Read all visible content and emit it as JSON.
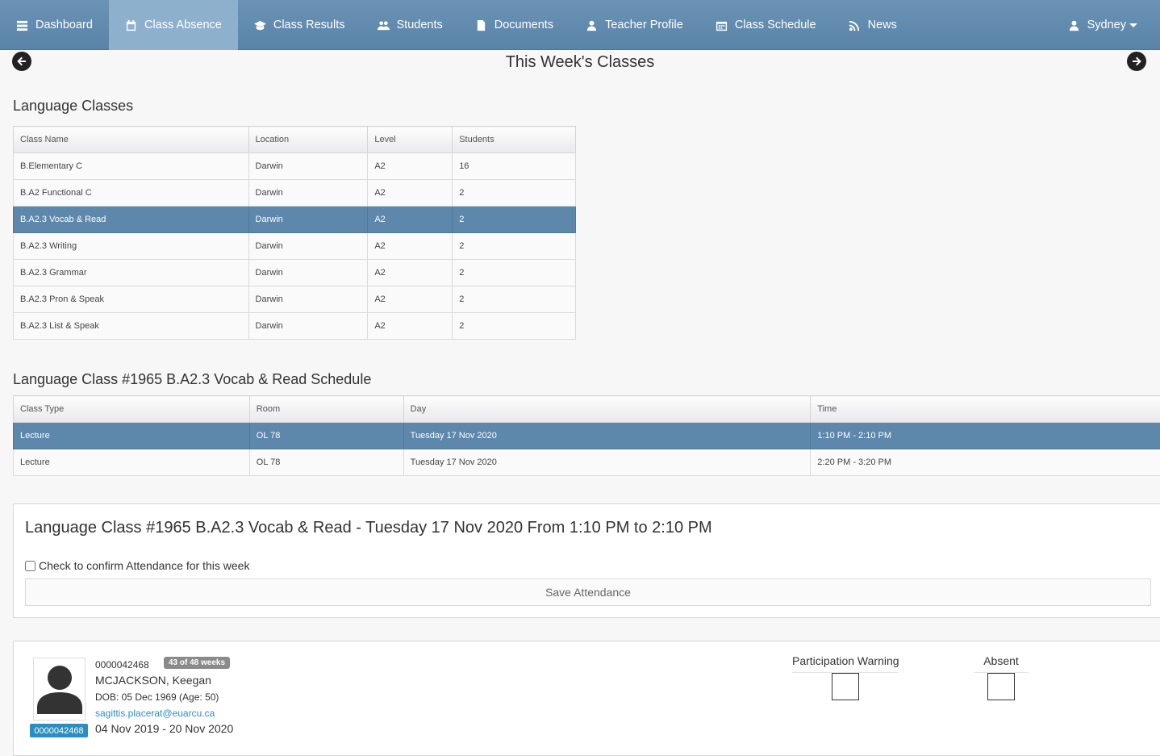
{
  "nav": {
    "items": [
      {
        "label": "Dashboard",
        "icon": "dashboard-icon"
      },
      {
        "label": "Class Absence",
        "icon": "calendar-icon",
        "active": true
      },
      {
        "label": "Class Results",
        "icon": "graduation-cap-icon"
      },
      {
        "label": "Students",
        "icon": "users-icon"
      },
      {
        "label": "Documents",
        "icon": "document-icon"
      },
      {
        "label": "Teacher Profile",
        "icon": "user-icon"
      },
      {
        "label": "Class Schedule",
        "icon": "calendar-grid-icon"
      },
      {
        "label": "News",
        "icon": "rss-icon"
      }
    ],
    "user": "Sydney"
  },
  "week": {
    "title": "This Week's Classes"
  },
  "language_classes": {
    "title": "Language Classes",
    "headers": [
      "Class Name",
      "Location",
      "Level",
      "Students"
    ],
    "rows": [
      [
        "B.Elementary C",
        "Darwin",
        "A2",
        "16"
      ],
      [
        "B.A2 Functional C",
        "Darwin",
        "A2",
        "2"
      ],
      [
        "B.A2.3 Vocab & Read",
        "Darwin",
        "A2",
        "2"
      ],
      [
        "B.A2.3 Writing",
        "Darwin",
        "A2",
        "2"
      ],
      [
        "B.A2.3 Grammar",
        "Darwin",
        "A2",
        "2"
      ],
      [
        "B.A2.3 Pron & Speak",
        "Darwin",
        "A2",
        "2"
      ],
      [
        "B.A2.3 List & Speak",
        "Darwin",
        "A2",
        "2"
      ]
    ],
    "selected_index": 2
  },
  "schedule": {
    "title": "Language Class #1965 B.A2.3 Vocab & Read Schedule",
    "headers": [
      "Class Type",
      "Room",
      "Day",
      "Time"
    ],
    "rows": [
      [
        "Lecture",
        "OL 78",
        "Tuesday 17 Nov 2020",
        "1:10 PM - 2:10 PM"
      ],
      [
        "Lecture",
        "OL 78",
        "Tuesday 17 Nov 2020",
        "2:20 PM - 3:20 PM"
      ]
    ],
    "selected_index": 0
  },
  "attendance": {
    "title": "Language Class #1965 B.A2.3 Vocab & Read - Tuesday 17 Nov 2020 From 1:10 PM to 2:10 PM",
    "confirm_label": "Check to confirm Attendance for this week",
    "save_label": "Save Attendance"
  },
  "student": {
    "id": "0000042468",
    "weeks": "43 of 48 weeks",
    "name": "MCJACKSON, Keegan",
    "dob": "DOB: 05 Dec 1969 (Age: 50)",
    "email": "sagittis.placerat@euarcu.ca",
    "dates": "04 Nov 2019 - 20 Nov 2020",
    "badge": "0000042468",
    "participation_label": "Participation Warning",
    "absent_label": "Absent"
  },
  "colors": {
    "nav": "#5a84a8",
    "selected_row": "#5d87ab",
    "badge": "#2a8fc0",
    "email": "#2a8fc0"
  }
}
